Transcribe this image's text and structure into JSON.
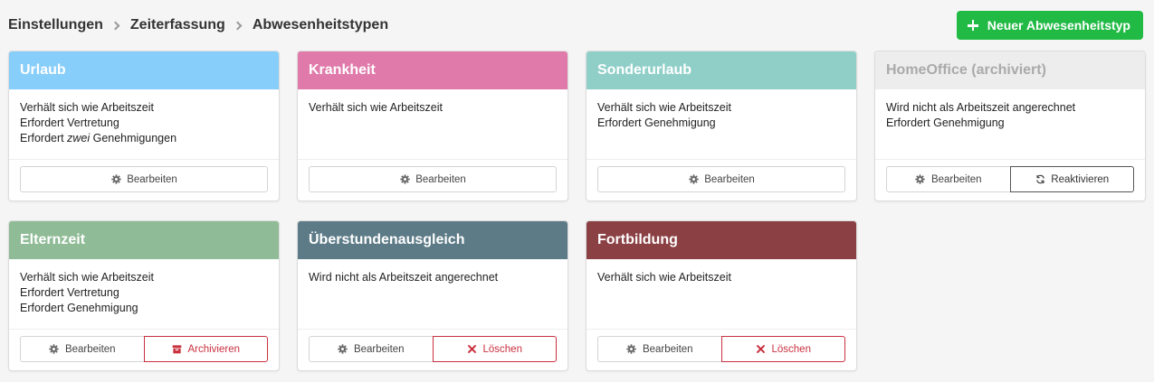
{
  "breadcrumb": [
    "Einstellungen",
    "Zeiterfassung",
    "Abwesenheitstypen"
  ],
  "add_button": "Neuer Abwesenheitstyp",
  "buttons": {
    "edit": "Bearbeiten",
    "archive": "Archivieren",
    "delete": "Löschen",
    "reactivate": "Reaktivieren"
  },
  "colors": {
    "accent_green": "#21ba45",
    "danger": "#c9303e"
  },
  "cards": [
    {
      "title": "Urlaub",
      "color": "#87cefa",
      "lines": [
        "Verhält sich wie Arbeitszeit",
        "Erfordert Vertretung",
        "Erfordert zwei Genehmigungen"
      ]
    },
    {
      "title": "Krankheit",
      "color": "#e07aaa",
      "lines": [
        "Verhält sich wie Arbeitszeit"
      ]
    },
    {
      "title": "Sonderurlaub",
      "color": "#8fcfc8",
      "lines": [
        "Verhält sich wie Arbeitszeit",
        "Erfordert Genehmigung"
      ]
    },
    {
      "title": "HomeOffice (archiviert)",
      "color": "#ededed",
      "lines": [
        "Wird nicht als Arbeitszeit angerechnet",
        "Erfordert Genehmigung"
      ]
    },
    {
      "title": "Elternzeit",
      "color": "#8fbb96",
      "lines": [
        "Verhält sich wie Arbeitszeit",
        "Erfordert Vertretung",
        "Erfordert Genehmigung"
      ]
    },
    {
      "title": "Überstundenausgleich",
      "color": "#5d7b87",
      "lines": [
        "Wird nicht als Arbeitszeit angerechnet"
      ]
    },
    {
      "title": "Fortbildung",
      "color": "#8b4044",
      "lines": [
        "Verhält sich wie Arbeitszeit"
      ]
    }
  ]
}
